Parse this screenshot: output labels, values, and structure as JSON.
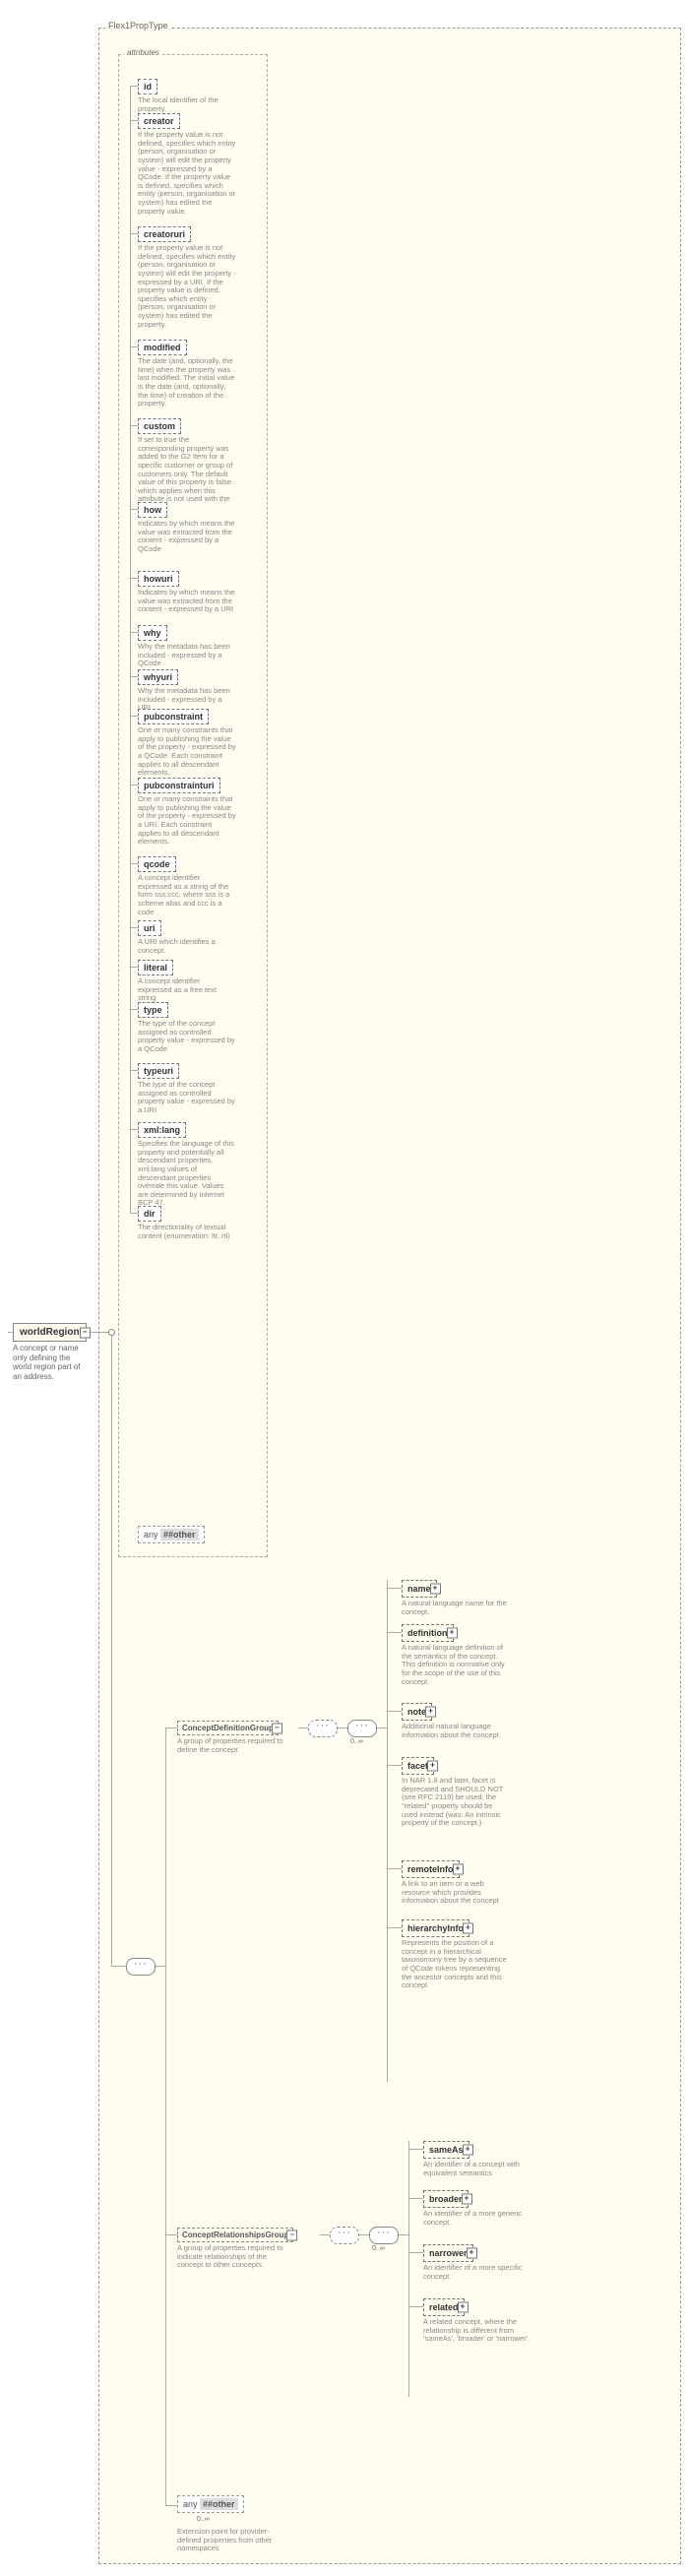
{
  "root": {
    "name": "worldRegion",
    "desc": "A concept or name only defining the world region part of an address."
  },
  "type_group": {
    "label": "Flex1PropType"
  },
  "attr_group": {
    "label": "attributes"
  },
  "attrs": [
    {
      "name": "id",
      "desc": "The local identifier of the property."
    },
    {
      "name": "creator",
      "desc": "If the property value is not defined, specifies which entity (person, organisation or system) will edit the property value - expressed by a QCode. If the property value is defined, specifies which entity (person, organisation or system) has edited the property value."
    },
    {
      "name": "creatoruri",
      "desc": "If the property value is not defined, specifies which entity (person, organisation or system) will edit the property - expressed by a URI. If the property value is defined, specifies which entity (person, organisation or system) has edited the property."
    },
    {
      "name": "modified",
      "desc": "The date (and, optionally, the time) when the property was last modified. The initial value is the date (and, optionally, the time) of creation of the property."
    },
    {
      "name": "custom",
      "desc": "If set to true the corresponding property was added to the G2 Item for a specific customer or group of customers only. The default value of this property is false which applies when this attribute is not used with the property."
    },
    {
      "name": "how",
      "desc": "Indicates by which means the value was extracted from the content - expressed by a QCode"
    },
    {
      "name": "howuri",
      "desc": "Indicates by which means the value was extracted from the content - expressed by a URI"
    },
    {
      "name": "why",
      "desc": "Why the metadata has been included - expressed by a QCode"
    },
    {
      "name": "whyuri",
      "desc": "Why the metadata has been included - expressed by a URI"
    },
    {
      "name": "pubconstraint",
      "desc": "One or many constraints that apply to publishing the value of the property - expressed by a QCode. Each constraint applies to all descendant elements."
    },
    {
      "name": "pubconstrainturi",
      "desc": "One or many constraints that apply to publishing the value of the property - expressed by a URI. Each constraint applies to all descendant elements."
    },
    {
      "name": "qcode",
      "desc": "A concept identifier expressed as a string of the form sss:ccc, where sss is a scheme alias and ccc is a code"
    },
    {
      "name": "uri",
      "desc": "A URI which identifies a concept."
    },
    {
      "name": "literal",
      "desc": "A concept identifier expressed as a free text string"
    },
    {
      "name": "type",
      "desc": "The type of the concept assigned as controlled property value - expressed by a QCode"
    },
    {
      "name": "typeuri",
      "desc": "The type of the concept assigned as controlled property value - expressed by a URI"
    },
    {
      "name": "xml:lang",
      "desc": "Specifies the language of this property and potentially all descendant properties. xml:lang values of descendant properties override this value. Values are determined by Internet BCP 47."
    },
    {
      "name": "dir",
      "desc": "The directionality of textual content (enumeration: ltr, rtl)"
    }
  ],
  "any1": {
    "label": "any",
    "ns": "##other"
  },
  "seq_connector": true,
  "group1": {
    "name": "ConceptDefinitionGroup",
    "desc": "A group of properties required to define the concept",
    "card": "0..∞"
  },
  "group2": {
    "name": "ConceptRelationshipsGroup",
    "desc": "A group of properties required to indicate relationships of the concept to other concepts",
    "card": "0..∞"
  },
  "any2": {
    "label": "any",
    "ns": "##other",
    "card": "0..∞",
    "desc": "Extension point for provider-defined properties from other namespaces"
  },
  "defGroupElems": [
    {
      "name": "name",
      "dashed": true,
      "desc": "A natural language name for the concept."
    },
    {
      "name": "definition",
      "dashed": true,
      "desc": "A natural language definition of the semantics of the concept. This definition is normative only for the scope of the use of this concept."
    },
    {
      "name": "note",
      "dashed": true,
      "desc": "Additional natural language information about the concept."
    },
    {
      "name": "facet",
      "dashed": true,
      "desc": "In NAR 1.8 and later, facet is deprecated and SHOULD NOT (see RFC 2119) be used, the \"related\" property should be used instead (was: An intrinsic property of the concept.)"
    },
    {
      "name": "remoteInfo",
      "dashed": true,
      "desc": "A link to an item or a web resource which provides information about the concept"
    },
    {
      "name": "hierarchyInfo",
      "dashed": true,
      "desc": "Represents the position of a concept in a hierarchical taxonomony tree by a sequence of QCode tokens representing the ancestor concepts and this concept"
    }
  ],
  "relGroupElems": [
    {
      "name": "sameAs",
      "dashed": true,
      "desc": "An identifier of a concept with equivalent semantics"
    },
    {
      "name": "broader",
      "dashed": true,
      "desc": "An identifier of a more generic concept."
    },
    {
      "name": "narrower",
      "dashed": true,
      "desc": "An identifier of a more specific concept."
    },
    {
      "name": "related",
      "dashed": true,
      "desc": "A related concept, where the relationship is different from 'sameAs', 'broader' or 'narrower'."
    }
  ]
}
